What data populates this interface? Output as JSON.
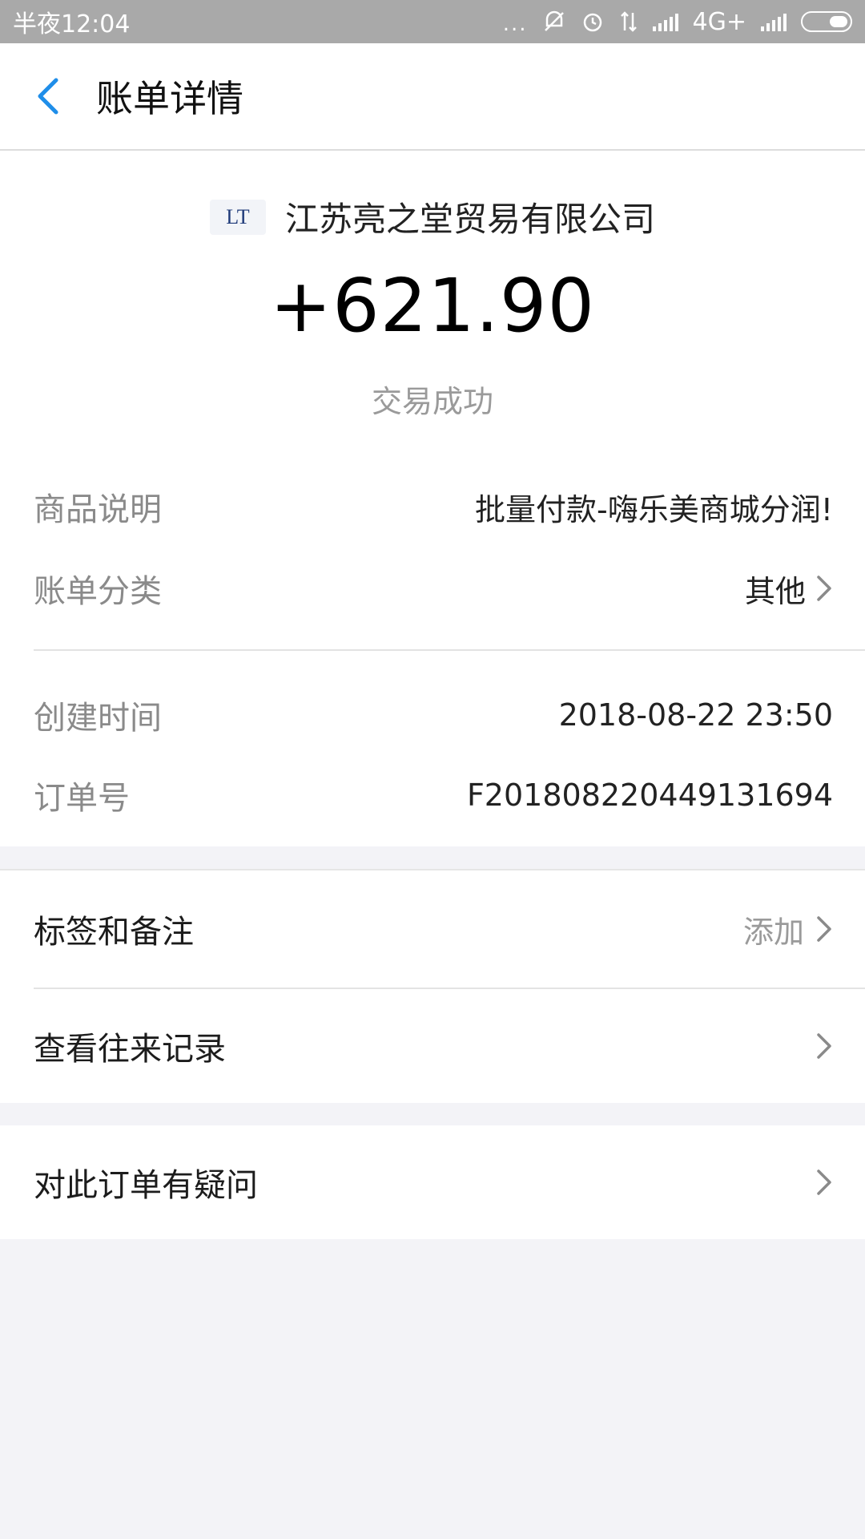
{
  "status_bar": {
    "time": "半夜12:04",
    "network": "4G+",
    "dots": "..."
  },
  "header": {
    "title": "账单详情"
  },
  "summary": {
    "merchant_name": "江苏亮之堂贸易有限公司",
    "logo_text": "LT",
    "amount": "+621.90",
    "status": "交易成功"
  },
  "details": {
    "product_label": "商品说明",
    "product_value": "批量付款-嗨乐美商城分润!",
    "category_label": "账单分类",
    "category_value": "其他",
    "created_label": "创建时间",
    "created_value": "2018-08-22 23:50",
    "order_label": "订单号",
    "order_value": "F201808220449131694"
  },
  "actions": {
    "tags_label": "标签和备注",
    "tags_action": "添加",
    "records_label": "查看往来记录",
    "question_label": "对此订单有疑问"
  },
  "colors": {
    "accent": "#1f8ee9",
    "muted": "#9a9a9a",
    "background": "#f3f3f7"
  }
}
